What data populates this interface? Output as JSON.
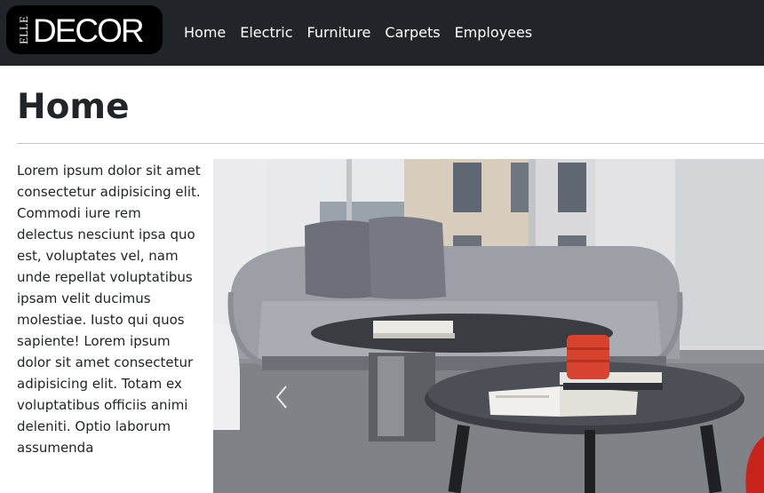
{
  "brand": {
    "prefix": "ELLE",
    "name": "DECOR"
  },
  "nav": {
    "items": [
      {
        "label": "Home"
      },
      {
        "label": "Electric"
      },
      {
        "label": "Furniture"
      },
      {
        "label": "Carpets"
      },
      {
        "label": "Employees"
      }
    ]
  },
  "page": {
    "title": "Home",
    "body": "Lorem ipsum dolor sit amet consectetur adipisicing elit. Commodi iure rem delectus nesciunt ipsa quo est, voluptates vel, nam unde repellat voluptatibus ipsam velit ducimus molestiae. Iusto qui quos sapiente! Lorem ipsum dolor sit amet consectetur adipisicing elit. Totam ex voluptatibus officiis animi deleniti. Optio laborum assumenda"
  },
  "carousel": {
    "image_subject": "living-room-sofa-coffee-tables",
    "prev_icon": "chevron-left-icon"
  },
  "colors": {
    "navbar_bg": "#212529",
    "nav_text": "#ffffff",
    "brand_bg": "#000000",
    "title_text": "#212529"
  }
}
